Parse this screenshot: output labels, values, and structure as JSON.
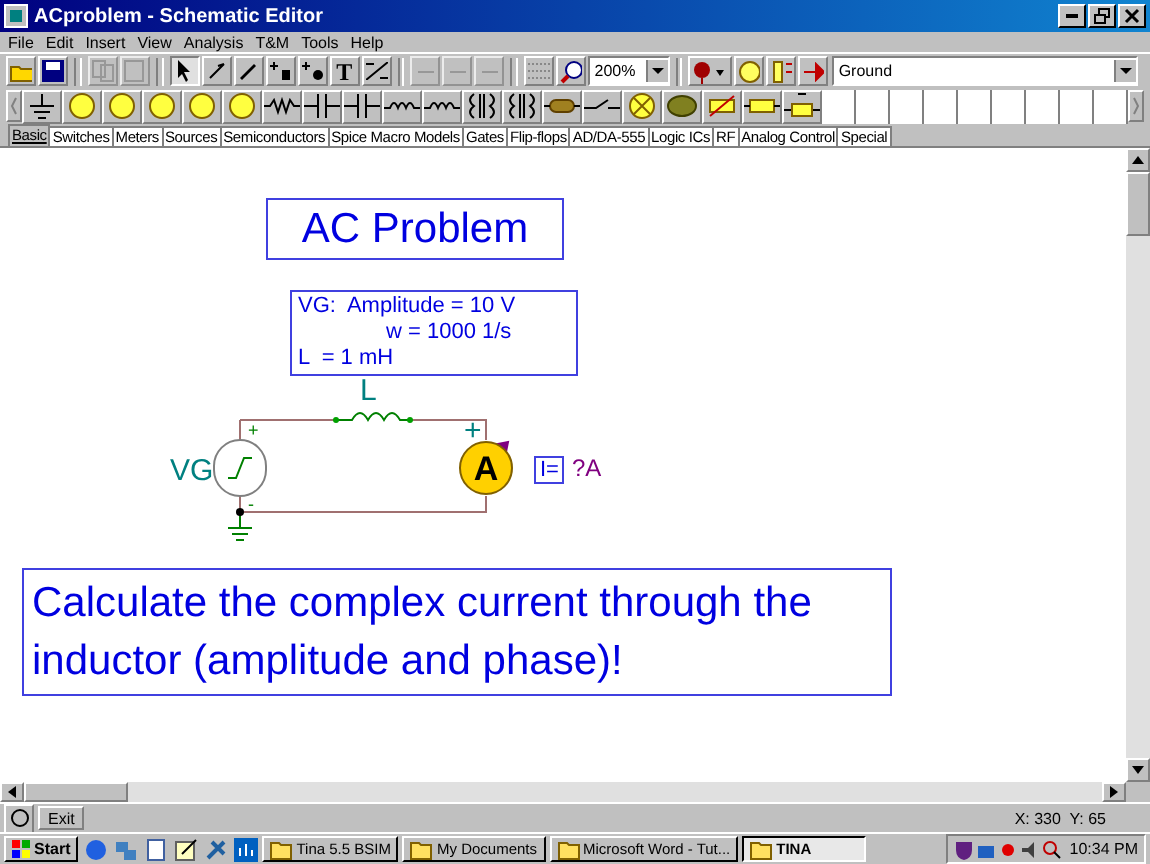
{
  "window": {
    "title": "ACproblem - Schematic Editor"
  },
  "menu": [
    "File",
    "Edit",
    "Insert",
    "View",
    "Analysis",
    "T&M",
    "Tools",
    "Help"
  ],
  "toolbar": {
    "text_tool": "T",
    "zoom": "200%",
    "component": "Ground"
  },
  "tabs": [
    {
      "label": "Basic",
      "selected": true
    },
    {
      "label": "Switches",
      "selected": false
    },
    {
      "label": "Meters",
      "selected": false
    },
    {
      "label": "Sources",
      "selected": false
    },
    {
      "label": "Semiconductors",
      "selected": false
    },
    {
      "label": "Spice Macro Models",
      "selected": false
    },
    {
      "label": "Gates",
      "selected": false
    },
    {
      "label": "Flip-flops",
      "selected": false
    },
    {
      "label": "AD/DA-555",
      "selected": false
    },
    {
      "label": "Logic ICs",
      "selected": false
    },
    {
      "label": "RF",
      "selected": false
    },
    {
      "label": "Analog Control",
      "selected": false
    },
    {
      "label": "Special",
      "selected": false
    }
  ],
  "canvas": {
    "title": "AC Problem",
    "params": [
      "VG:  Amplitude = 10 V",
      "w = 1000 1/s",
      "L  = 1 mH"
    ],
    "circuit": {
      "inductor_label": "L",
      "source_label": "VG",
      "source_plus": "+",
      "source_minus": "-",
      "meter_plus": "+",
      "meter_symbol": "A",
      "meter_readout": "I=",
      "meter_value": "?A"
    },
    "task": "Calculate the complex current through the inductor (amplitude and phase)!"
  },
  "status_bar": {
    "button": "Exit",
    "coords": "X: 330  Y: 65"
  },
  "taskbar": {
    "start": "Start",
    "tasks": [
      {
        "label": "Tina 5.5 BSIM",
        "selected": false
      },
      {
        "label": "My Documents",
        "selected": false
      },
      {
        "label": "Microsoft Word - Tut...",
        "selected": false
      },
      {
        "label": "TINA",
        "selected": true
      }
    ],
    "clock": "10:34 PM"
  }
}
